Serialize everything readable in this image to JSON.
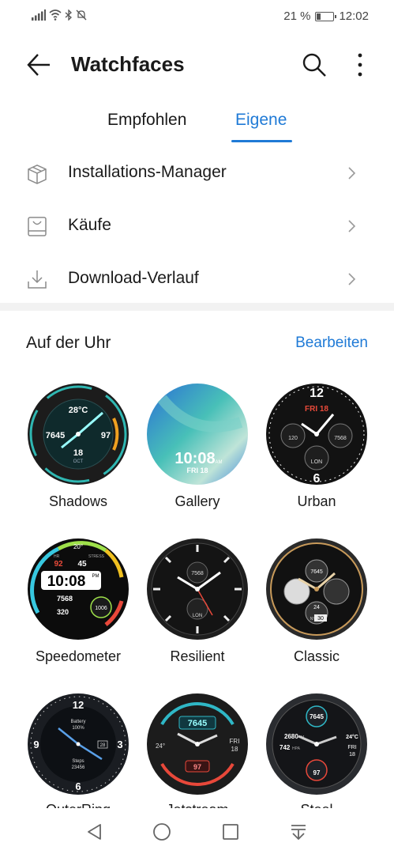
{
  "status": {
    "battery_percent": "21 %",
    "time": "12:02",
    "battery_level": 0.21
  },
  "app_bar": {
    "title": "Watchfaces",
    "back_icon": "arrow-left-icon",
    "search_icon": "search-icon",
    "more_icon": "more-vertical-icon"
  },
  "tabs": [
    {
      "label": "Empfohlen",
      "selected": false
    },
    {
      "label": "Eigene",
      "selected": true
    }
  ],
  "menu": [
    {
      "label": "Installations-Manager",
      "icon": "package-box-icon"
    },
    {
      "label": "Käufe",
      "icon": "shopping-bag-icon"
    },
    {
      "label": "Download-Verlauf",
      "icon": "download-icon"
    }
  ],
  "section": {
    "title": "Auf der Uhr",
    "action": "Bearbeiten"
  },
  "watchfaces": [
    {
      "name": "Shadows",
      "texts": [
        "28°C",
        "7645",
        "97",
        "18",
        "OCT"
      ]
    },
    {
      "name": "Gallery",
      "texts": [
        "10:08",
        "AM",
        "FRI 18"
      ]
    },
    {
      "name": "Urban",
      "texts": [
        "FRI 18",
        "120",
        "7568",
        "LON",
        "12",
        "6"
      ]
    },
    {
      "name": "Speedometer",
      "texts": [
        "20°",
        "92",
        "45",
        "10:08",
        "PM",
        "7568",
        "320",
        "1006",
        "STRESS",
        "HR"
      ]
    },
    {
      "name": "Resilient",
      "texts": [
        "7568",
        "LON"
      ]
    },
    {
      "name": "Classic",
      "texts": [
        "7645",
        "24",
        "NYC",
        "30"
      ]
    },
    {
      "name": "OuterRing",
      "texts": [
        "12",
        "3",
        "6",
        "9",
        "Battery",
        "100%",
        "28",
        "Steps",
        "23456"
      ]
    },
    {
      "name": "Jetstream",
      "texts": [
        "7645",
        "24°",
        "FRI",
        "18",
        "97"
      ]
    },
    {
      "name": "Steel",
      "texts": [
        "7645",
        "2680",
        "M",
        "742",
        "HPA",
        "24°C",
        "FRI",
        "18",
        "97"
      ]
    }
  ],
  "colors": {
    "accent": "#1f7ad6",
    "text": "#1a1a1a",
    "icon": "#8a8a8a",
    "divider": "#f2f2f2"
  },
  "nav": {
    "back_icon": "triangle-back-icon",
    "home_icon": "circle-home-icon",
    "recents_icon": "square-recents-icon",
    "notifications_icon": "notification-pulldown-icon"
  }
}
